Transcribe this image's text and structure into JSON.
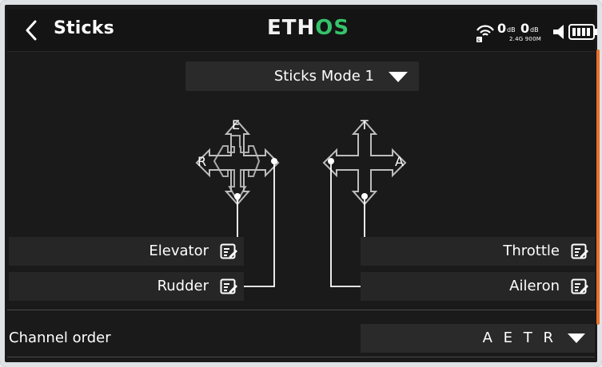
{
  "header": {
    "title": "Sticks",
    "brand_part1": "ETH",
    "brand_part2": "OS",
    "rx1_db": "0",
    "rx2_db": "0",
    "db_unit": "dB",
    "bands": "2.4G 900M"
  },
  "mode": {
    "value": "Sticks Mode 1"
  },
  "diagram": {
    "left_stick": {
      "up": "E",
      "left": "R"
    },
    "right_stick": {
      "up": "T",
      "right": "A"
    }
  },
  "functions": {
    "elevator": "Elevator",
    "rudder": "Rudder",
    "throttle": "Throttle",
    "aileron": "Aileron"
  },
  "channel_order": {
    "label": "Channel order",
    "value": "A E T R"
  },
  "icons": {
    "back": "chevron-left-icon",
    "edit": "edit-icon",
    "wifi": "telemetry-signal-icon",
    "volume": "speaker-icon",
    "battery": "battery-icon",
    "dropdown": "triangle-down-icon"
  },
  "colors": {
    "accent": "#e8722b",
    "brand_green": "#35c46a",
    "background": "#1a1a1a",
    "field": "#262626"
  }
}
